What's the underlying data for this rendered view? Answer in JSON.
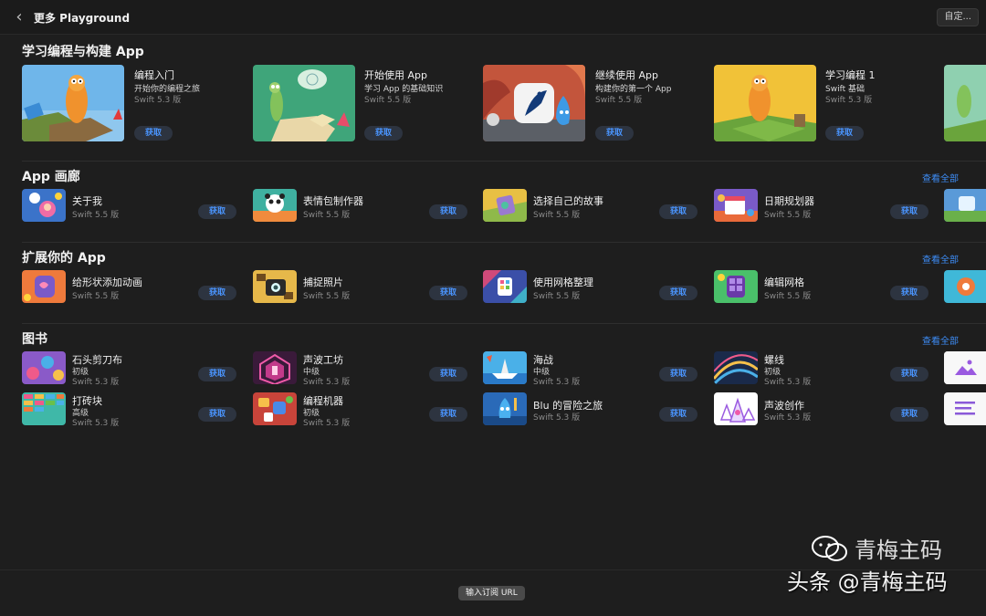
{
  "window": {
    "title": "更多 Playground",
    "back_icon": "chevron-left-icon",
    "customize_label": "自定..."
  },
  "colors": {
    "background": "#1e1e1e",
    "accent": "#3d8cf5",
    "get_button_bg": "#2d3440"
  },
  "sections": {
    "learn": {
      "title": "学习编程与构建 App",
      "items": [
        {
          "title": "编程入门",
          "subtitle": "开始你的编程之旅",
          "version": "Swift 5.3 版",
          "get": "获取",
          "thumb": "byte-character-island"
        },
        {
          "title": "开始使用 App",
          "subtitle": "学习 App 的基础知识",
          "version": "Swift 5.5 版",
          "get": "获取",
          "thumb": "green-character-thinking"
        },
        {
          "title": "继续使用 App",
          "subtitle": "构建你的第一个 App",
          "version": "Swift 5.5 版",
          "get": "获取",
          "thumb": "peacock-app-icon"
        },
        {
          "title": "学习编程 1",
          "subtitle": "Swift 基础",
          "version": "Swift 5.3 版",
          "get": "获取",
          "thumb": "byte-character-yellow"
        }
      ]
    },
    "gallery": {
      "title": "App 画廊",
      "see_all": "查看全部",
      "items": [
        {
          "title": "关于我",
          "version": "Swift 5.5 版",
          "get": "获取"
        },
        {
          "title": "表情包制作器",
          "version": "Swift 5.5 版",
          "get": "获取"
        },
        {
          "title": "选择自己的故事",
          "version": "Swift 5.5 版",
          "get": "获取"
        },
        {
          "title": "日期规划器",
          "version": "Swift 5.5 版",
          "get": "获取"
        }
      ]
    },
    "extend": {
      "title": "扩展你的 App",
      "see_all": "查看全部",
      "items": [
        {
          "title": "给形状添加动画",
          "version": "Swift 5.5 版",
          "get": "获取"
        },
        {
          "title": "捕捉照片",
          "version": "Swift 5.5 版",
          "get": "获取"
        },
        {
          "title": "使用网格整理",
          "version": "Swift 5.5 版",
          "get": "获取"
        },
        {
          "title": "编辑网格",
          "version": "Swift 5.5 版",
          "get": "获取"
        }
      ]
    },
    "books": {
      "title": "图书",
      "see_all": "查看全部",
      "items": [
        {
          "title": "石头剪刀布",
          "level": "初级",
          "version": "Swift 5.3 版",
          "get": "获取"
        },
        {
          "title": "声波工坊",
          "level": "中级",
          "version": "Swift 5.3 版",
          "get": "获取"
        },
        {
          "title": "海战",
          "level": "中级",
          "version": "Swift 5.3 版",
          "get": "获取"
        },
        {
          "title": "螺线",
          "level": "初级",
          "version": "Swift 5.3 版",
          "get": "获取"
        },
        {
          "title": "打砖块",
          "level": "高级",
          "version": "Swift 5.3 版",
          "get": "获取"
        },
        {
          "title": "编程机器",
          "level": "初级",
          "version": "Swift 5.3 版",
          "get": "获取"
        },
        {
          "title": "Blu 的冒险之旅",
          "version": "Swift 5.3 版",
          "get": "获取"
        },
        {
          "title": "声波创作",
          "version": "Swift 5.3 版",
          "get": "获取"
        }
      ]
    }
  },
  "footer": {
    "subscribe_url_label": "输入订阅 URL"
  },
  "watermark": {
    "top_text": "青梅主码",
    "bottom_text": "头条 @青梅主码",
    "icon": "wechat-icon"
  }
}
